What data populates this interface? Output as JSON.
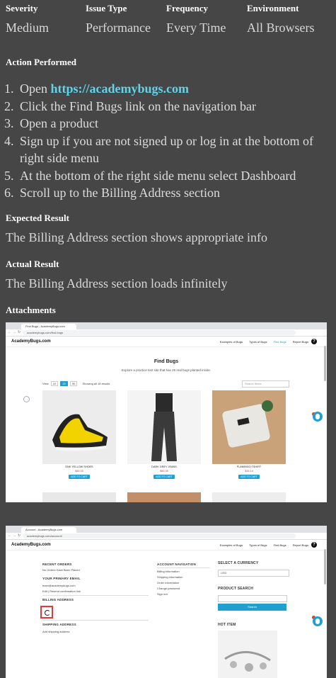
{
  "meta": {
    "severity_label": "Severity",
    "severity_value": "Medium",
    "issue_type_label": "Issue Type",
    "issue_type_value": "Performance",
    "frequency_label": "Frequency",
    "frequency_value": "Every Time",
    "environment_label": "Environment",
    "environment_value": "All Browsers"
  },
  "action": {
    "heading": "Action Performed",
    "steps": [
      {
        "num": "1.",
        "text": "Open ",
        "link": "https://academybugs.com"
      },
      {
        "num": "2.",
        "text": "Click the Find Bugs link on the navigation bar"
      },
      {
        "num": "3.",
        "text": "Open a product"
      },
      {
        "num": "4.",
        "text": "Sign up if you are not signed up or log in at the bottom of right side menu"
      },
      {
        "num": "5.",
        "text": "At the bottom of the right side menu select Dashboard"
      },
      {
        "num": "6.",
        "text": "Scroll up to the Billing Address section"
      }
    ]
  },
  "expected": {
    "heading": "Expected Result",
    "text": "The Billing Address section shows appropriate info"
  },
  "actual": {
    "heading": "Actual Result",
    "text": "The Billing Address section loads infinitely"
  },
  "attachments": {
    "heading": "Attachments"
  },
  "shot1": {
    "tab_title": "Find Bugs - AcademyBugs.com",
    "url": "academybugs.com/find-bugs",
    "logo": "AcademyBugs.com",
    "menu": [
      "Examples of Bugs",
      "Types of Bugs",
      "Find Bugs",
      "Report Bugs"
    ],
    "help_glyph": "?",
    "title": "Find Bugs",
    "subtitle": "Explore a practice test site that has 25 real bugs planted inside.",
    "view_label": "View",
    "pages": [
      "10",
      "20",
      "50"
    ],
    "showing": "Showing all 18 results",
    "search_placeholder": "Search items",
    "products": [
      {
        "name": "DNK YELLOW SHOES",
        "price": "$45.00",
        "button": "ADD TO CART",
        "color": "#e9e9e9"
      },
      {
        "name": "DARK GREY JEANS",
        "price": "$90.00",
        "button": "ADD TO CART",
        "color": "#f4f4f4"
      },
      {
        "name": "FLAMINGO TSHIRT",
        "price": "$15.14",
        "button": "ADD TO CART",
        "color": "#c9a27a"
      }
    ],
    "colors": {
      "accent": "#1fa0d0",
      "bug_dot": "#ee3333"
    }
  },
  "shot2": {
    "tab_title": "Account - AcademyBugs.com",
    "url": "academybugs.com/account/",
    "logo": "AcademyBugs.com",
    "menu": [
      "Examples of Bugs",
      "Types of Bugs",
      "Find Bugs",
      "Report Bugs"
    ],
    "help_glyph": "?",
    "recent_orders": "RECENT ORDERS",
    "no_orders": "No Orders Have Been Placed",
    "primary_email": "YOUR PRIMARY EMAIL",
    "email_value": "team@academybugs.com",
    "change_email": "Edit | Resend confirmation link",
    "billing_address": "BILLING ADDRESS",
    "shipping_address": "SHIPPING ADDRESS",
    "add_shipping": "Add shipping address",
    "account_nav": "ACCOUNT NAVIGATION",
    "nav_items": [
      "Billing information",
      "Shipping information",
      "Order information",
      "Change password",
      "Sign out"
    ],
    "select_currency": "SELECT A CURRENCY",
    "currency_value": "USD",
    "product_search": "PRODUCT SEARCH",
    "search_button": "Search",
    "hot_item": "HOT ITEM"
  }
}
